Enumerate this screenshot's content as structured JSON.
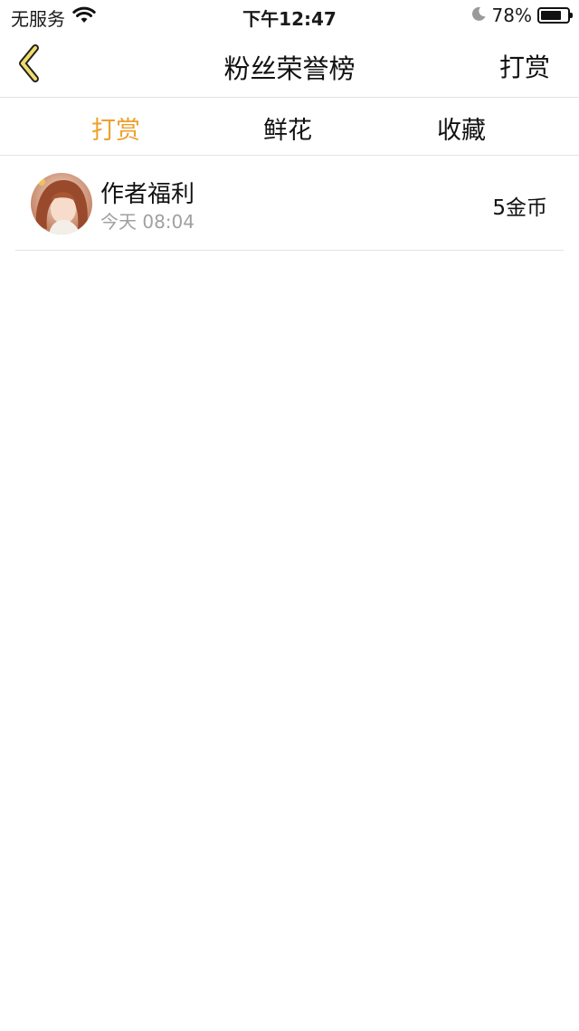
{
  "status_bar": {
    "carrier": "无服务",
    "time": "下午12:47",
    "battery_percent": "78%",
    "battery_level": 0.78
  },
  "nav": {
    "title": "粉丝荣誉榜",
    "action_label": "打赏",
    "back_icon": "chevron-left-icon",
    "accent_color": "#eea12c"
  },
  "tabs": [
    {
      "label": "打赏",
      "active": true
    },
    {
      "label": "鲜花",
      "active": false
    },
    {
      "label": "收藏",
      "active": false
    }
  ],
  "list": [
    {
      "name": "作者福利",
      "time": "今天 08:04",
      "value": "5金币"
    }
  ]
}
